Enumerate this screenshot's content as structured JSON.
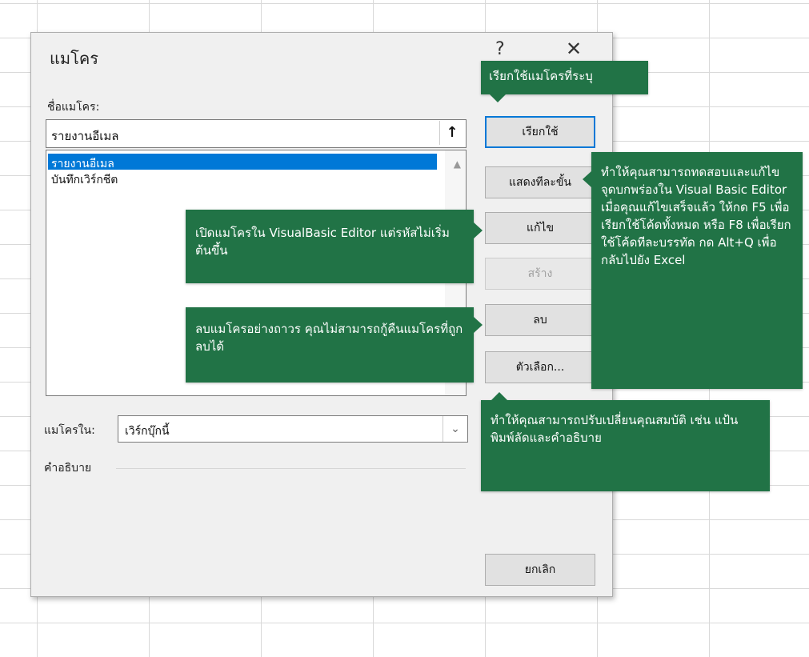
{
  "dialog": {
    "title": "แมโคร",
    "help_glyph": "?",
    "close_glyph": "✕",
    "macro_name_label": "ชื่อแมโคร:",
    "macro_name_value": "รายงานอีเมล",
    "macros": [
      "รายงานอีเมล",
      "บันทึกเวิร์กชีต"
    ],
    "macros_in_label": "แมโครใน:",
    "macros_in_value": "เวิร์กบุ๊กนี้",
    "description_label": "คำอธิบาย"
  },
  "buttons": {
    "run": "เรียกใช้",
    "step_into": "แสดงทีละขั้น",
    "edit": "แก้ไข",
    "create": "สร้าง",
    "delete": "ลบ",
    "options": "ตัวเลือก...",
    "cancel": "ยกเลิก"
  },
  "callouts": {
    "run": "เรียกใช้แมโครที่ระบุ",
    "step_into": "ทำให้คุณสามารถทดสอบและแก้ไขจุดบกพร่องใน Visual Basic Editor เมื่อคุณแก้ไขเสร็จแล้ว ให้กด F5 เพื่อเรียกใช้โค้ดทั้งหมด หรือ F8 เพื่อเรียกใช้โค้ดทีละบรรทัด กด Alt+Q เพื่อกลับไปยัง Excel",
    "edit": "เปิดแมโครใน VisualBasic Editor แต่รหัสไม่เริ่มต้นขึ้น",
    "delete": "ลบแมโครอย่างถาวร คุณไม่สามารถกู้คืนแมโครที่ถูกลบได้",
    "options": "ทำให้คุณสามารถปรับเปลี่ยนคุณสมบัติ เช่น แป้นพิมพ์ลัดและคำอธิบาย"
  },
  "colors": {
    "callout_bg": "#217346",
    "selection": "#0078d7"
  },
  "icons": {
    "upload": "upload-icon",
    "dropdown": "chevron-down-icon"
  }
}
